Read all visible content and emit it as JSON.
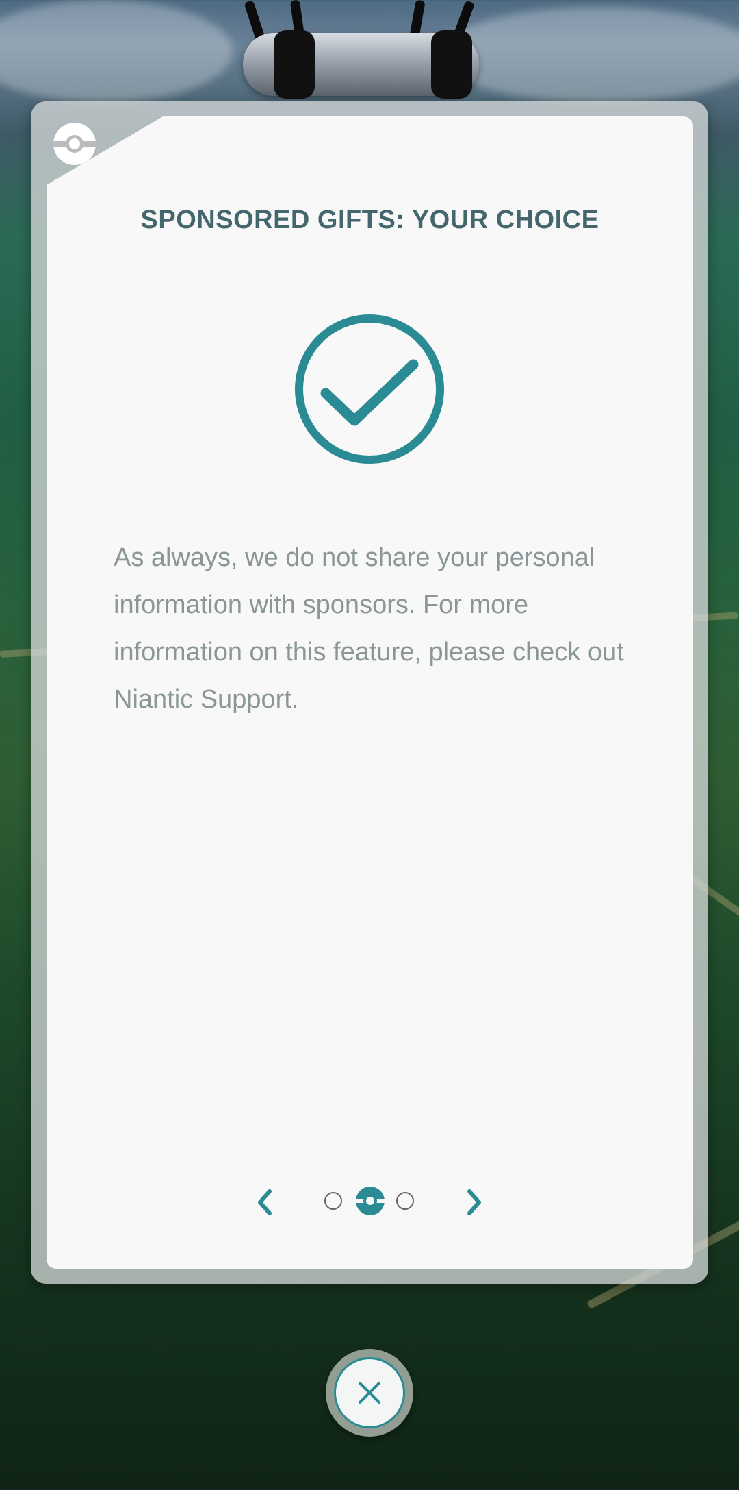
{
  "dialog": {
    "title": "SPONSORED GIFTS: YOUR CHOICE",
    "body": "As always, we do not share your personal information with sponsors. For more information on this feature, please check out Niantic Support."
  },
  "icons": {
    "corner": "pokeball-icon",
    "status": "checkmark-circle-icon",
    "prev": "chevron-left-icon",
    "next": "chevron-right-icon",
    "active_page": "pokeball-icon",
    "close": "close-icon"
  },
  "pagination": {
    "total_pages": 3,
    "current_page": 2
  },
  "colors": {
    "accent": "#2a8b94",
    "title": "#44666d",
    "body_text": "#8b9696",
    "card_background": "#f8f8f8"
  }
}
